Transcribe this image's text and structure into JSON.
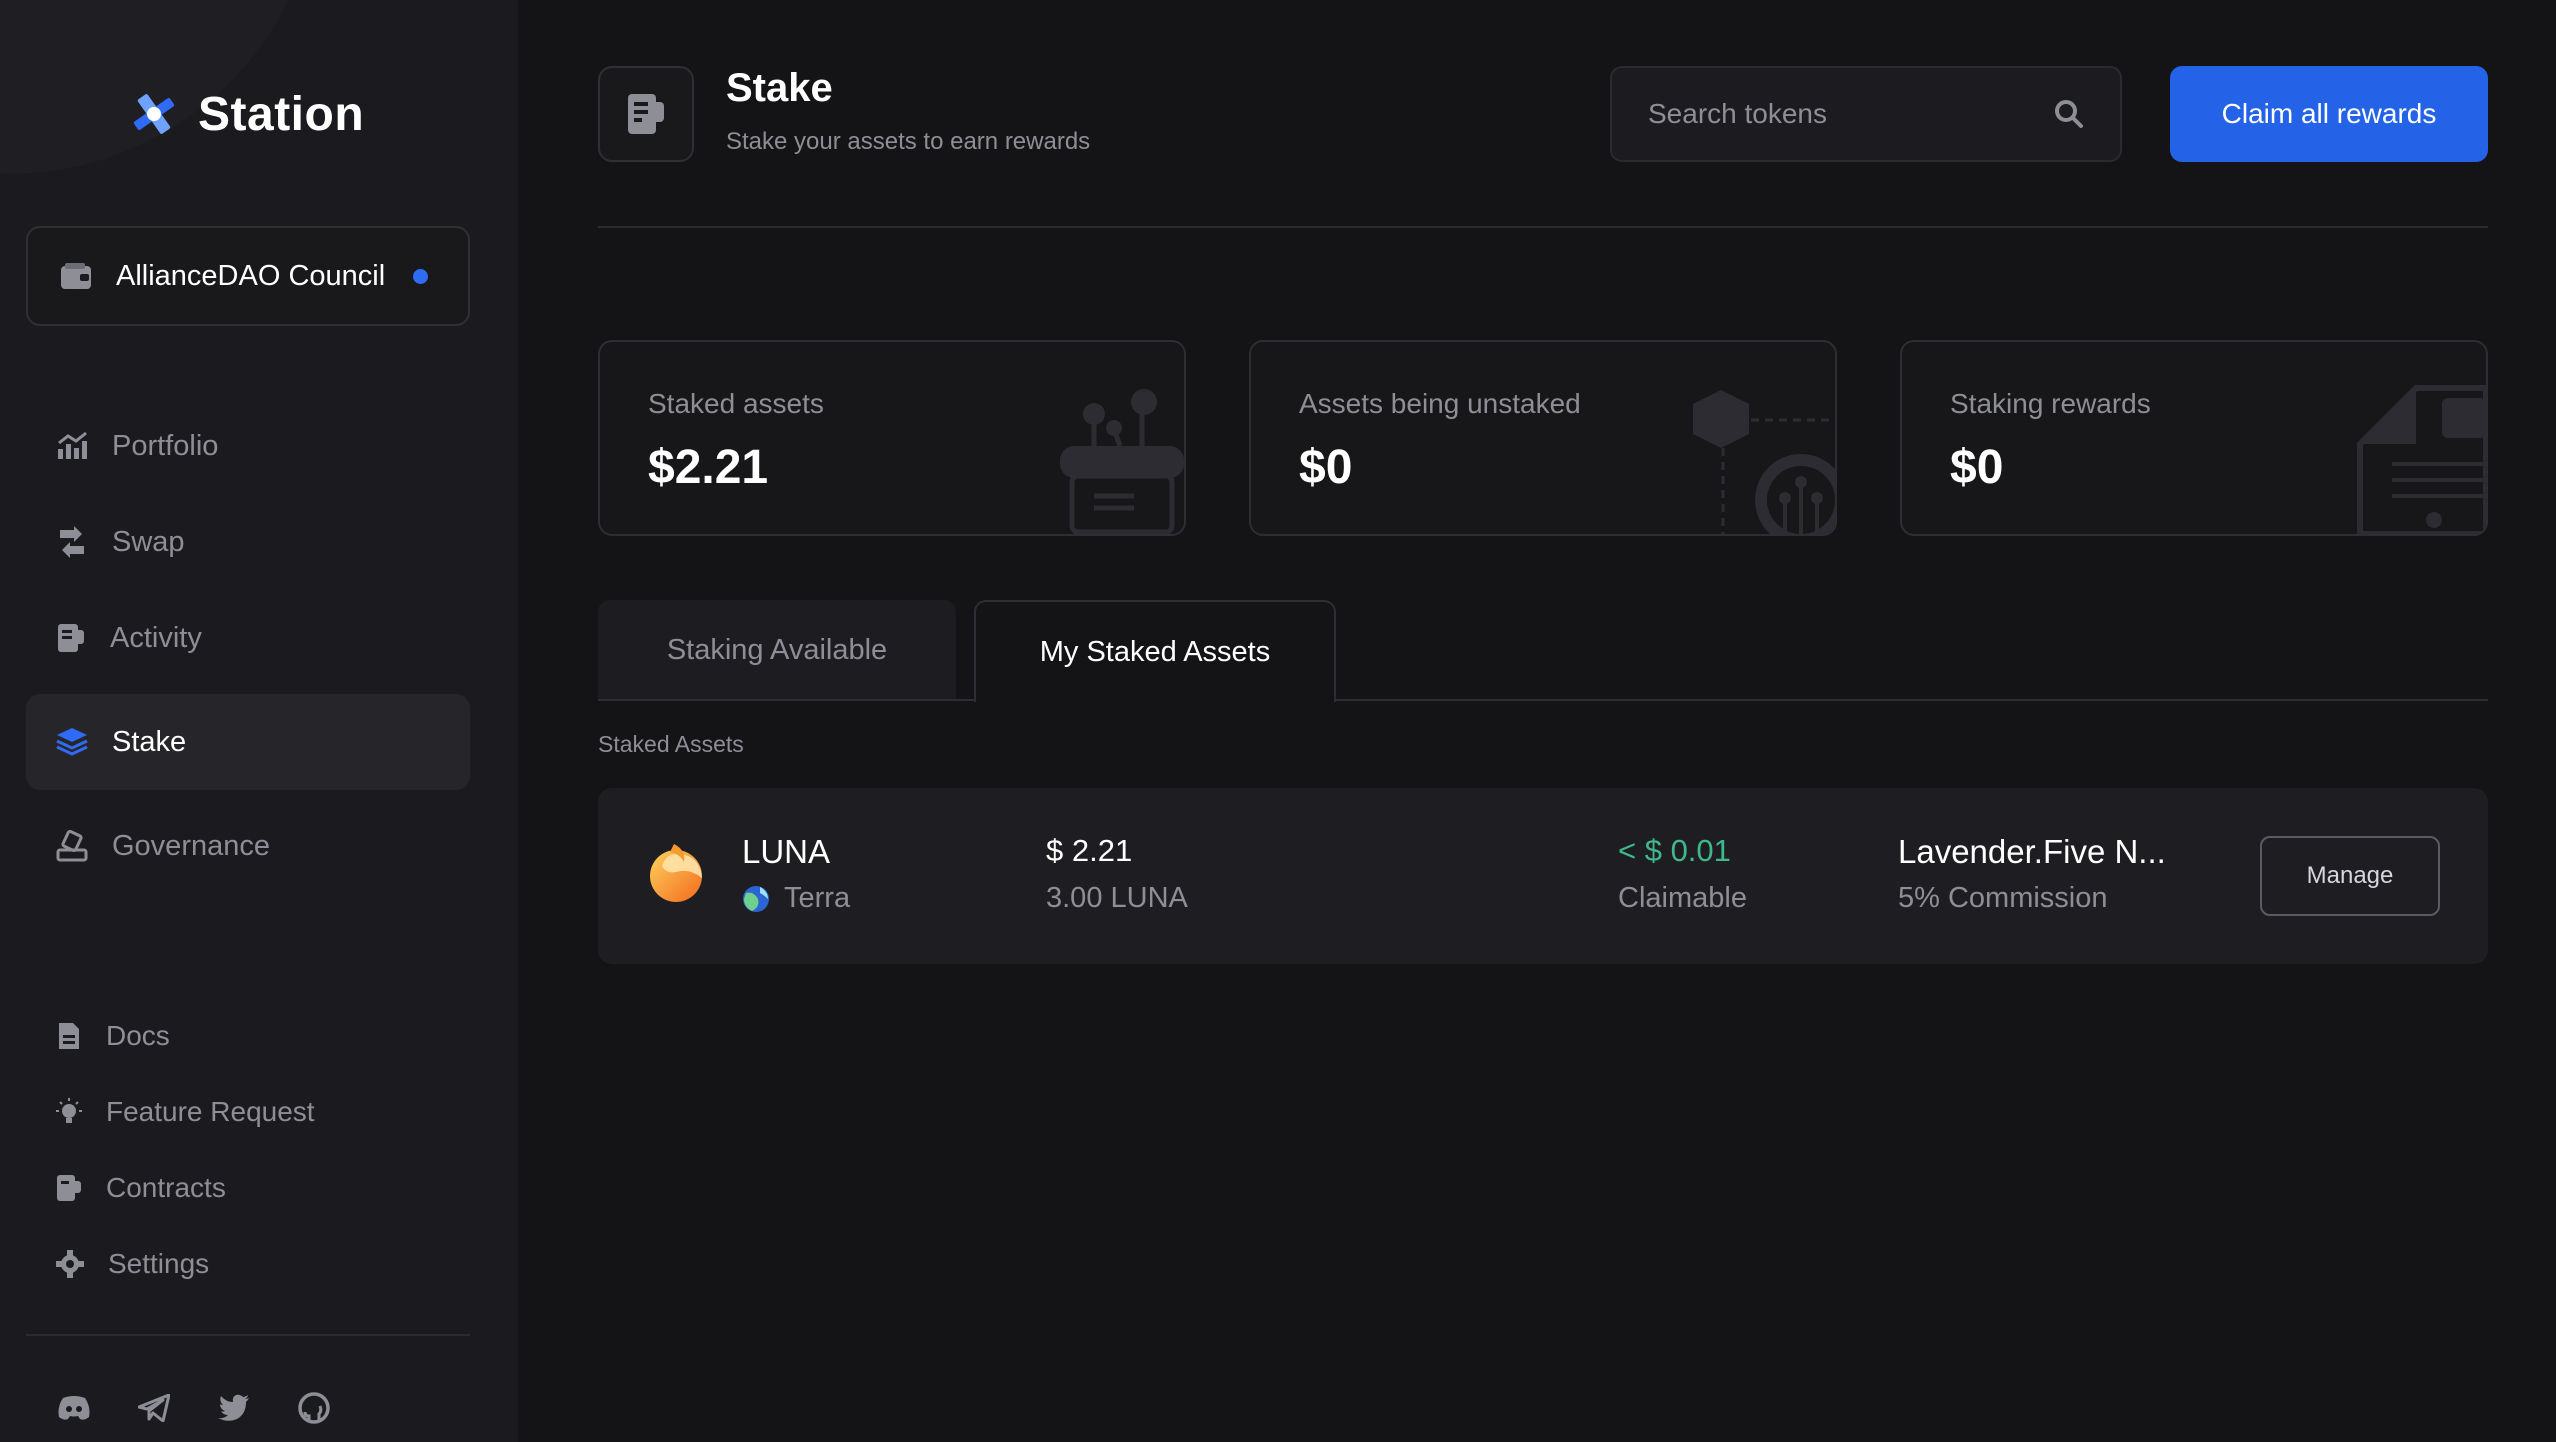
{
  "app": {
    "name": "Station"
  },
  "wallet": {
    "name": "AllianceDAO Council",
    "status_color": "#2f6bf5"
  },
  "nav": {
    "items": [
      {
        "label": "Portfolio",
        "icon": "chart-icon"
      },
      {
        "label": "Swap",
        "icon": "swap-icon"
      },
      {
        "label": "Activity",
        "icon": "receipt-icon"
      },
      {
        "label": "Stake",
        "icon": "layers-icon",
        "active": true
      },
      {
        "label": "Governance",
        "icon": "vote-icon"
      }
    ],
    "secondary": [
      {
        "label": "Docs",
        "icon": "document-icon"
      },
      {
        "label": "Feature Request",
        "icon": "lightbulb-icon"
      },
      {
        "label": "Contracts",
        "icon": "contract-icon"
      },
      {
        "label": "Settings",
        "icon": "gear-icon"
      }
    ],
    "social": [
      "discord-icon",
      "telegram-icon",
      "twitter-icon",
      "github-icon"
    ]
  },
  "header": {
    "title": "Stake",
    "subtitle": "Stake your assets to earn rewards",
    "search_placeholder": "Search tokens",
    "claim_label": "Claim all rewards",
    "accent": "#2463e8"
  },
  "stats": [
    {
      "label": "Staked assets",
      "value": "$2.21"
    },
    {
      "label": "Assets being unstaked",
      "value": "$0"
    },
    {
      "label": "Staking rewards",
      "value": "$0"
    }
  ],
  "tabs": [
    {
      "label": "Staking Available",
      "active": false
    },
    {
      "label": "My Staked Assets",
      "active": true
    }
  ],
  "section_label": "Staked Assets",
  "staked_assets": [
    {
      "token": "LUNA",
      "chain": "Terra",
      "value": "$ 2.21",
      "amount": "3.00 LUNA",
      "reward": "< $ 0.01",
      "reward_label": "Claimable",
      "validator": "Lavender.Five N...",
      "commission": "5% Commission",
      "action": "Manage",
      "reward_color": "#3fb98a"
    }
  ]
}
